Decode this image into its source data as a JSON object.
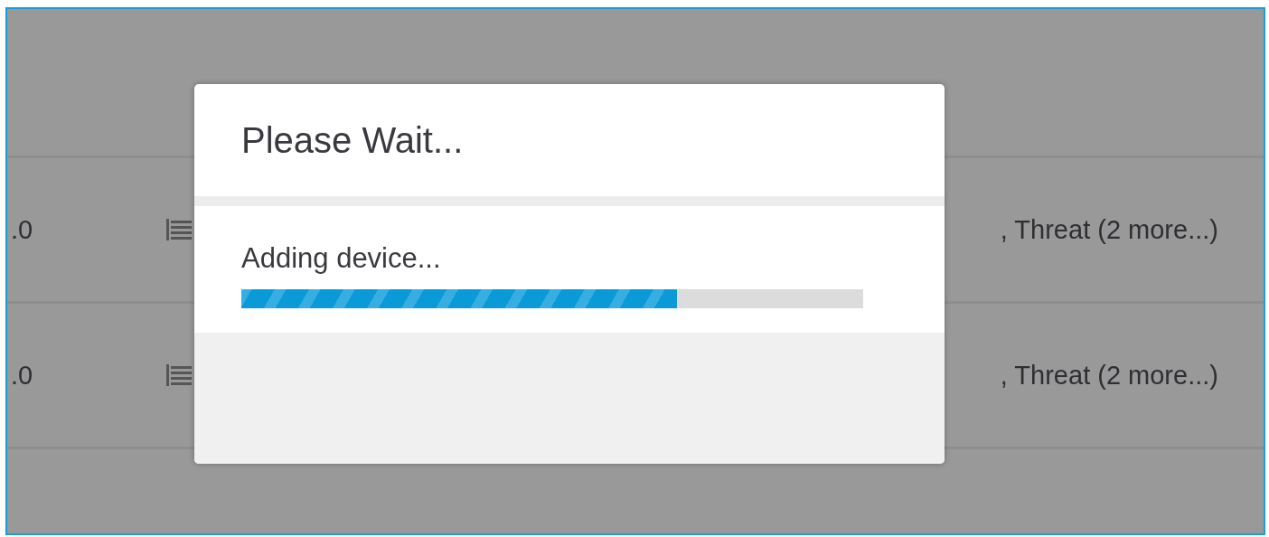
{
  "table": {
    "rows": [
      {
        "column_1": ".0",
        "column_3": ", Threat (2 more...)"
      },
      {
        "column_1": ".0",
        "column_3": ", Threat (2 more...)"
      }
    ]
  },
  "dialog": {
    "title": "Please Wait...",
    "message": "Adding device...",
    "progress": {
      "level": 0.7
    }
  }
}
